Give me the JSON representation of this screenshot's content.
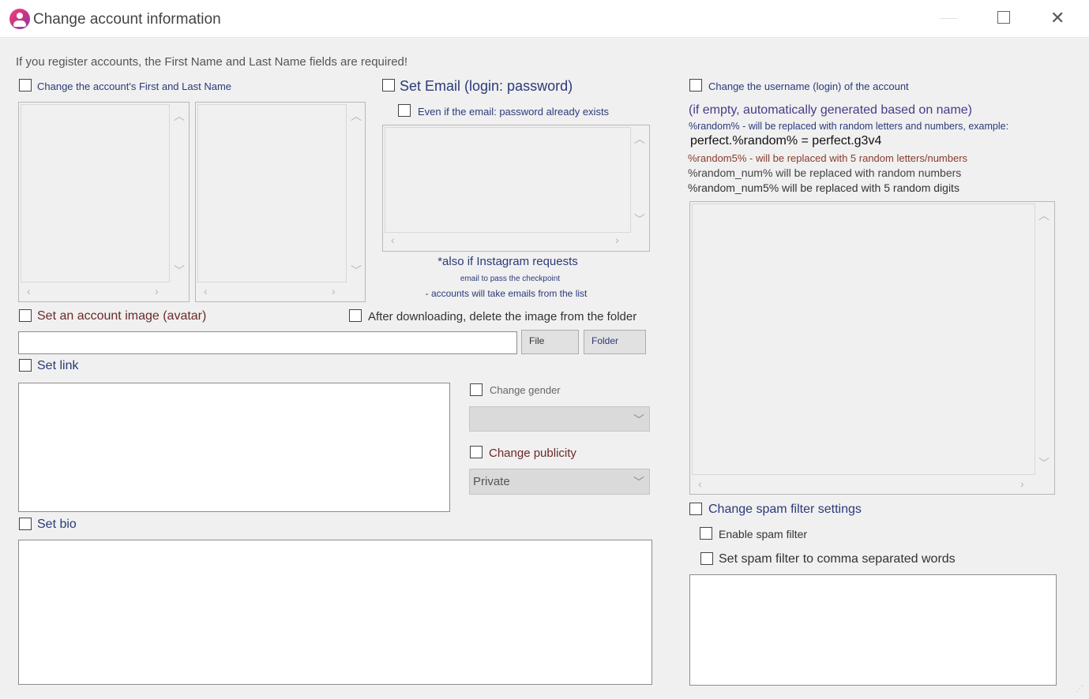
{
  "window": {
    "title": "Change account information",
    "app_icon": "user-profile-icon",
    "controls": {
      "maximize": "maximize-icon",
      "close": "close-icon"
    }
  },
  "notice": "If you register accounts, the First Name and Last Name fields are required!",
  "names": {
    "label": "Change the account's First and Last Name"
  },
  "email": {
    "label": "Set Email (login: password)",
    "even_if_exists_label": "Even if the email: password already exists",
    "note_line1": "*also if Instagram requests",
    "note_line2": "email to pass the checkpoint",
    "note_line3": "- accounts will take emails from the list"
  },
  "avatar": {
    "label": "Set an account image (avatar)",
    "delete_after_label": "After downloading, delete the image from the folder",
    "path_value": "",
    "file_button": "File",
    "folder_button": "Folder"
  },
  "link": {
    "label": "Set link"
  },
  "gender": {
    "label": "Change gender",
    "selected": ""
  },
  "publicity": {
    "label": "Change publicity",
    "selected": "Private"
  },
  "bio": {
    "label": "Set bio"
  },
  "username": {
    "label": "Change the username (login) of the account",
    "hint_empty": "(if empty, automatically generated based on name)",
    "hint_random": "%random% - will be replaced with random letters and numbers, example:",
    "hint_example": "perfect.%random% = perfect.g3v4",
    "hint_random5": "%random5% - will be replaced with 5 random letters/numbers",
    "hint_random_num": "%random_num% will be replaced with random numbers",
    "hint_random_num5": "%random_num5% will be replaced with 5 random digits"
  },
  "spam": {
    "label": "Change spam filter settings",
    "enable_label": "Enable spam filter",
    "words_label": "Set spam filter to comma separated words"
  },
  "colors": {
    "navy": "#2b3a7a",
    "brown": "#8a3b2a",
    "maroon": "#6b2a2a",
    "purple": "#4a3a8a"
  }
}
